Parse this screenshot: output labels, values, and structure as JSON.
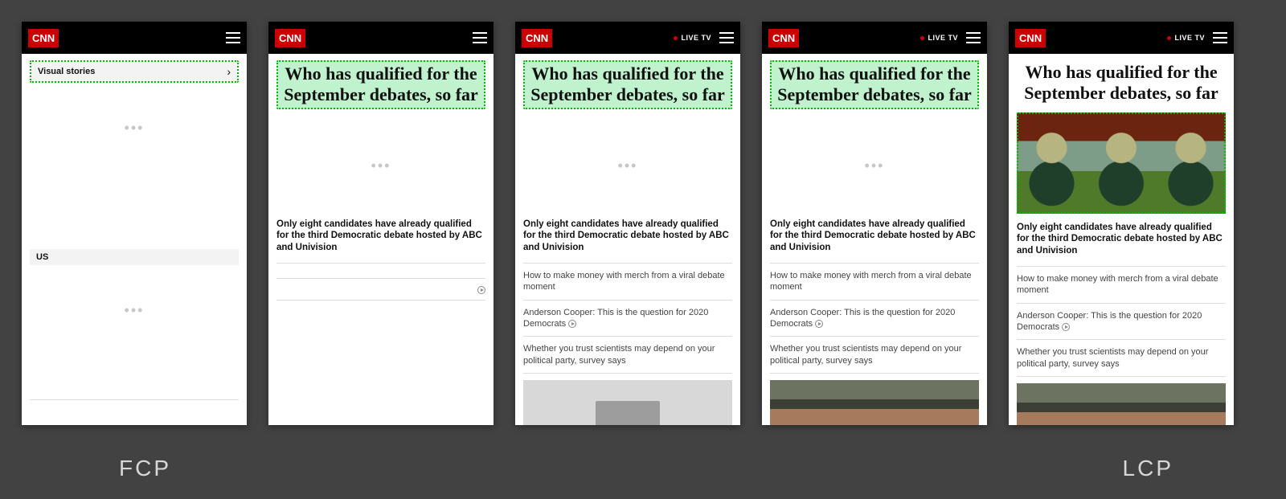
{
  "metrics": {
    "fcp_label": "FCP",
    "lcp_label": "LCP"
  },
  "header": {
    "logo_text": "CNN",
    "live_tv_label": "LIVE TV"
  },
  "frame1": {
    "section_label": "Visual stories",
    "section2_label": "US"
  },
  "article": {
    "headline": "Who has qualified for the September debates, so far",
    "lead": "Only eight candidates have already qualified for the third Democratic debate hosted by ABC and Univision",
    "stories": [
      "How to make money with merch from a viral debate moment",
      "Anderson Cooper: This is the question for 2020 Democrats",
      "Whether you trust scientists may depend on your political party, survey says"
    ]
  }
}
